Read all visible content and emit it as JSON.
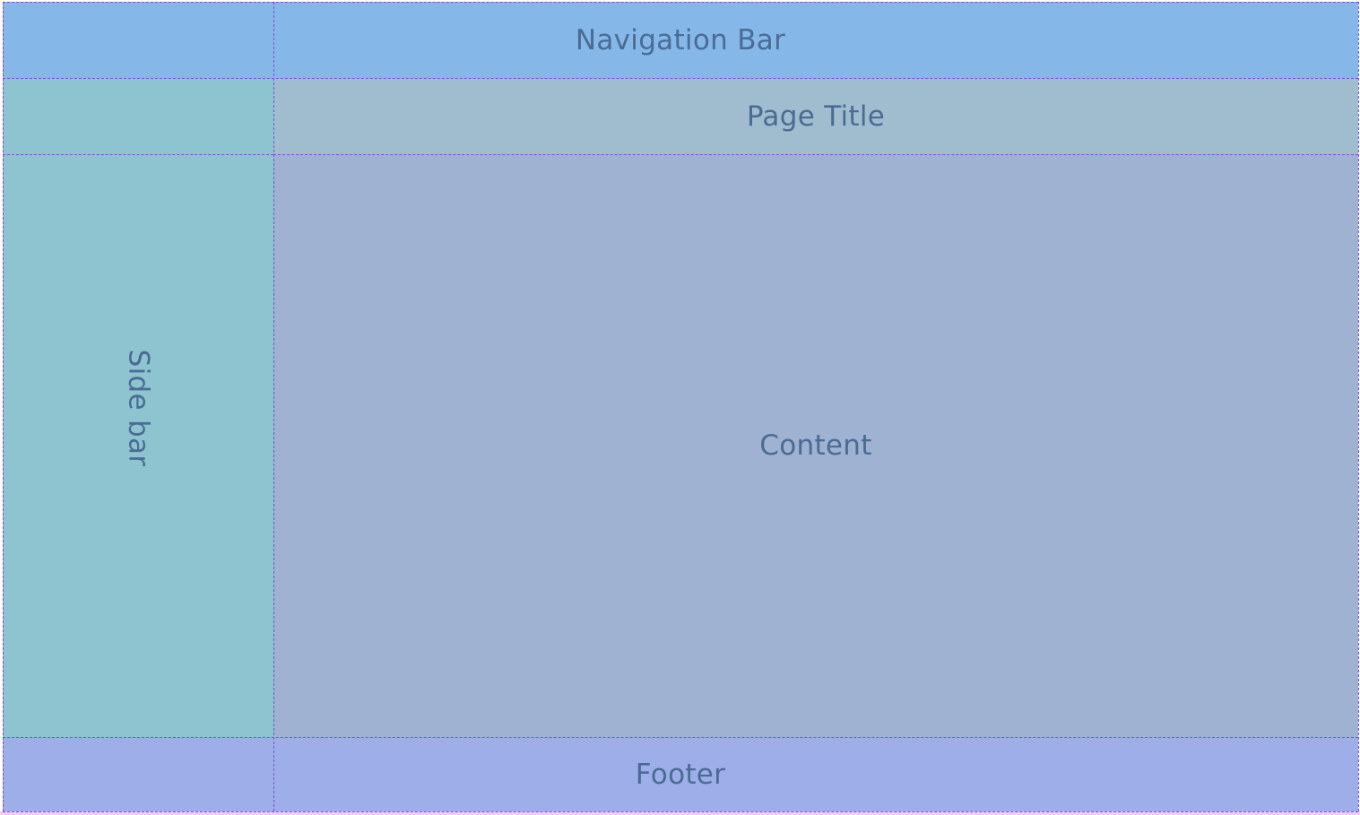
{
  "layout": {
    "navigation_bar": {
      "label": "Navigation Bar",
      "color": "#85b8e8"
    },
    "page_title": {
      "label": "Page Title",
      "color": "#a0bdd0"
    },
    "sidebar": {
      "label": "Side bar",
      "color": "#8dc4d0"
    },
    "content": {
      "label": "Content",
      "color": "#a0b2d1"
    },
    "footer": {
      "label": "Footer",
      "color": "#9eaee9"
    }
  },
  "colors": {
    "text": "#4a6b94",
    "grid_line": "#7a4fd6"
  }
}
